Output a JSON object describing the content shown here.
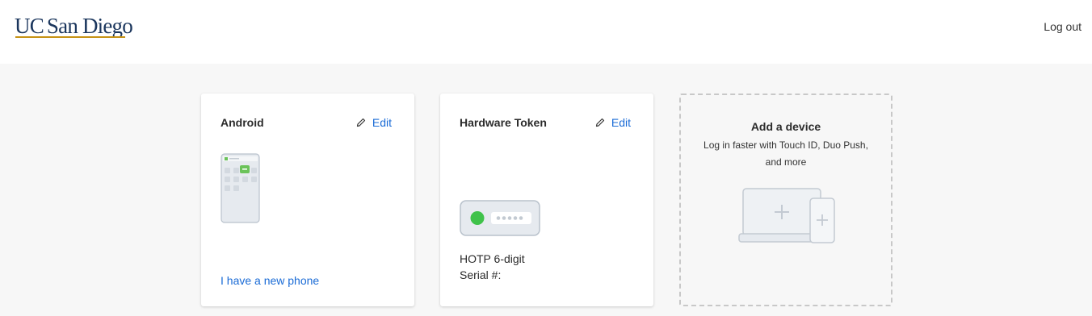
{
  "header": {
    "logo_uc": "UC",
    "logo_rest": "San Diego",
    "logout_label": "Log out"
  },
  "devices": [
    {
      "name": "Android",
      "edit_label": "Edit",
      "link_label": "I have a new phone",
      "icon": "android-phone-icon"
    },
    {
      "name": "Hardware Token",
      "edit_label": "Edit",
      "type_label": "HOTP 6-digit",
      "serial_label": "Serial #:",
      "icon": "hardware-token-icon"
    }
  ],
  "add_device": {
    "title": "Add a device",
    "subtitle": "Log in faster with Touch ID, Duo Push, and more",
    "icon": "add-device-icon"
  },
  "colors": {
    "link": "#1a6bd6",
    "logo": "#1b365d",
    "logo_accent": "#c69214",
    "token_led": "#3fc24a",
    "phone_accent": "#6bc35a"
  }
}
